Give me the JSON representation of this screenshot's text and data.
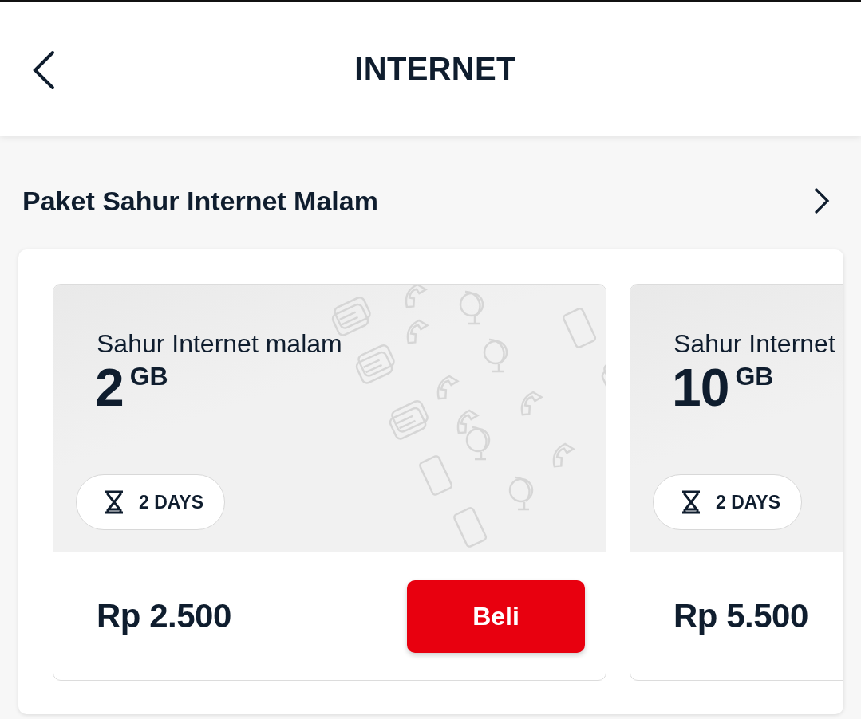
{
  "header": {
    "title": "INTERNET"
  },
  "section": {
    "title": "Paket Sahur Internet Malam"
  },
  "packages": [
    {
      "name": "Sahur Internet malam",
      "quota": "2",
      "unit": "GB",
      "duration": "2 DAYS",
      "price": "Rp 2.500",
      "button": "Beli"
    },
    {
      "name": "Sahur Internet",
      "quota": "10",
      "unit": "GB",
      "duration": "2 DAYS",
      "price": "Rp 5.500"
    }
  ]
}
